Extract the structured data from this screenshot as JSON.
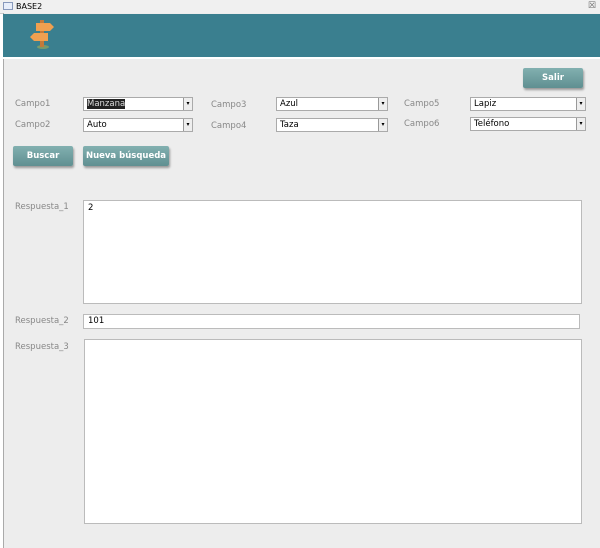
{
  "window": {
    "title": "BASE2",
    "close": "☒"
  },
  "buttons": {
    "salir": "Salir",
    "buscar": "Buscar",
    "nueva": "Nueva búsqueda"
  },
  "fields": [
    {
      "label": "Campo1",
      "value": "Manzana"
    },
    {
      "label": "Campo2",
      "value": "Auto"
    },
    {
      "label": "Campo3",
      "value": "Azul"
    },
    {
      "label": "Campo4",
      "value": "Taza"
    },
    {
      "label": "Campo5",
      "value": "Lapiz"
    },
    {
      "label": "Campo6",
      "value": "Teléfono"
    }
  ],
  "answers": [
    {
      "label": "Respuesta_1",
      "value": "2"
    },
    {
      "label": "Respuesta_2",
      "value": "101"
    },
    {
      "label": "Respuesta_3",
      "value": ""
    }
  ],
  "arrow": "▾"
}
